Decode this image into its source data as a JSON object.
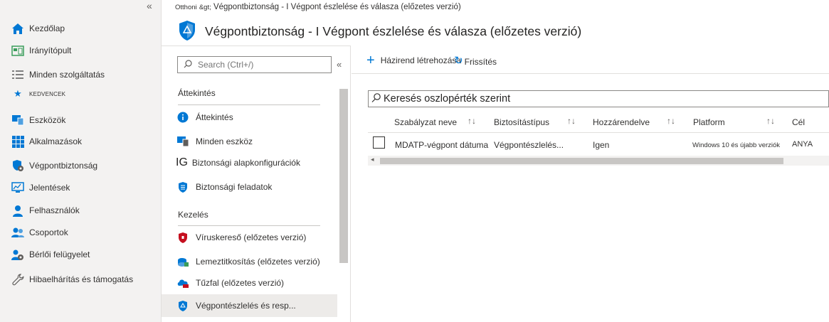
{
  "breadcrumb": {
    "home": "Otthoni",
    "separator": "&gt;",
    "current": "Végpontbiztonság - I Végpont észlelése és válasza (előzetes verzió)"
  },
  "header": {
    "title": "Végpontbiztonság - I Végpont észlelése és válasza (előzetes verzió)"
  },
  "leftnav": {
    "collapse": "«",
    "items": [
      {
        "label": "Kezdőlap",
        "icon": "home-icon"
      },
      {
        "label": "Irányítópult",
        "icon": "dashboard-icon"
      },
      {
        "label": "Minden szolgáltatás",
        "icon": "list-icon"
      },
      {
        "label": "Eszközök",
        "icon": "devices-icon"
      },
      {
        "label": "Alkalmazások",
        "icon": "apps-grid-icon"
      },
      {
        "label": "Végpontbiztonság",
        "icon": "endpoint-security-icon"
      },
      {
        "label": "Jelentések",
        "icon": "reports-icon"
      },
      {
        "label": "Felhasználók",
        "icon": "user-icon"
      },
      {
        "label": "Csoportok",
        "icon": "groups-icon"
      },
      {
        "label": "Bérlői felügyelet",
        "icon": "tenant-admin-icon"
      },
      {
        "label": "Hibaelhárítás és támogatás",
        "icon": "wrench-icon"
      }
    ],
    "favorites_label": "KEDVENCEK"
  },
  "midmenu": {
    "search_placeholder": "Search (Ctrl+/)",
    "collapse": "«",
    "section_overview": "Áttekintés",
    "overview_items": [
      {
        "label": "Áttekintés",
        "icon": "info-icon"
      },
      {
        "label": "Minden eszköz",
        "icon": "devices-icon"
      },
      {
        "label": "Biztonsági alapkonfigurációk",
        "icon_text": "IG"
      },
      {
        "label": "Biztonsági feladatok",
        "icon": "security-tasks-icon"
      }
    ],
    "section_manage": "Kezelés",
    "manage_items": [
      {
        "label": "Víruskereső (előzetes verzió)",
        "icon": "antivirus-shield-icon"
      },
      {
        "label": "Lemeztitkosítás (előzetes verzió)",
        "icon": "disk-encryption-icon"
      },
      {
        "label": "Tűzfal (előzetes verzió)",
        "icon": "firewall-icon"
      },
      {
        "label": "Végpontészlelés és resp...",
        "icon": "edr-shield-icon"
      }
    ]
  },
  "toolbar": {
    "create_label": "Házirend létrehozása",
    "refresh_label": "Frissítés"
  },
  "filter": {
    "value": "Keresés oszlopérték szerint"
  },
  "table": {
    "columns": [
      "Szabályzat neve",
      "Biztosítástípus",
      "Hozzárendelve",
      "Platform",
      "Cél"
    ],
    "rows": [
      {
        "name": "MDATP-végpont dátuma",
        "type": "Végpontészlelés...",
        "assigned": "Igen",
        "platform": "Windows 10 és újabb verziók",
        "target": "ANYA"
      }
    ]
  },
  "colors": {
    "accent": "#0078d4",
    "nav_bg": "#f3f2f1",
    "selected_bg": "#edebe9"
  }
}
